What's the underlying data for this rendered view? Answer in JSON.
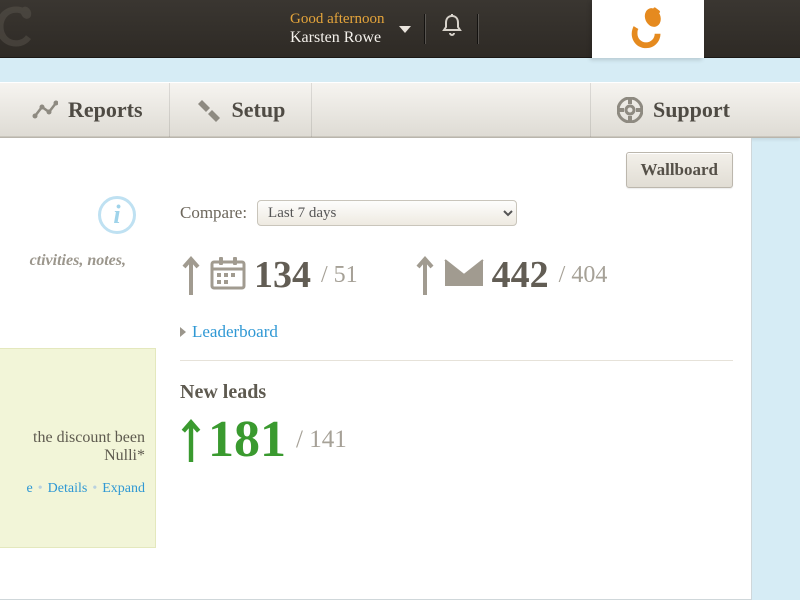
{
  "header": {
    "greeting": "Good afternoon",
    "username": "Karsten Rowe"
  },
  "nav": {
    "reports": "Reports",
    "setup": "Setup",
    "support": "Support"
  },
  "toolbar": {
    "wallboard": "Wallboard"
  },
  "left": {
    "hint": "ctivities, notes,",
    "note_line": "the discount been",
    "note_by": "Nulli*",
    "link_details": "Details",
    "link_expand": "Expand",
    "link_e": "e"
  },
  "compare": {
    "label": "Compare:",
    "selected": "Last 7 days"
  },
  "stats": {
    "calendar": {
      "value": "134",
      "compare": "51"
    },
    "mail": {
      "value": "442",
      "compare": "404"
    }
  },
  "leaderboard": {
    "label": "Leaderboard"
  },
  "newleads": {
    "label": "New leads",
    "value": "181",
    "compare": "141"
  }
}
